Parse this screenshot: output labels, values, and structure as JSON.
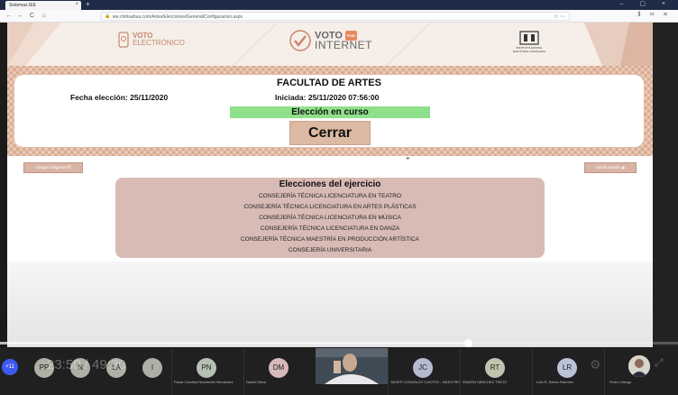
{
  "browser": {
    "tab_title": "Sistemas IEE",
    "tab_close": "×",
    "new_tab": "+",
    "window_controls": "– ▢ ×",
    "nav_back": "←",
    "nav_forward": "→",
    "nav_reload": "C",
    "nav_home": "⌂",
    "url": "iee.chihuahua.com/Artes/Elecciones/General/Configuracion.aspx",
    "url_actions": "☆ ⋯",
    "toolbar_icons": "⫴ ▭ ≡"
  },
  "header": {
    "logo_left_line1": "VOTO",
    "logo_left_line2": "ELECTRÓNICO",
    "logo_center_line1": "VOTO",
    "logo_center_badge": "POR",
    "logo_center_line2": "INTERNET",
    "logo_right_text": "INSTITUTO ESTATAL ELECTORAL CHIHUAHUA"
  },
  "election": {
    "faculty": "FACULTAD DE ARTES",
    "fecha": "Fecha elección: 25/11/2020",
    "iniciada": "Iniciada: 25/11/2020 07:56:00",
    "status": "Elección en curso",
    "close_label": "Cerrar"
  },
  "actions": {
    "left_button": "Cargar imágenes ⎘",
    "right_button": "Cerrar sesión ⏏"
  },
  "elections_list": {
    "title": "Elecciones del ejercicio",
    "items": [
      "CONSEJERÍA TÉCNICA LICENCIATURA EN TEATRO",
      "CONSEJERÍA TÉCNICA LICENCIATURA EN ARTES PLÁSTICAS",
      "CONSEJERÍA TÉCNICA LICENCIATURA EN MÚSICA",
      "CONSEJERÍA TÉCNICA LICENCIATURA EN DANZA",
      "CONSEJERÍA TÉCNICA MAESTRÍA EN PRODUCCIÓN ARTÍSTICA",
      "CONSEJERÍA UNIVERSITARIA"
    ]
  },
  "video": {
    "timecode": "23:50 / 49:30",
    "progress": 0.69
  },
  "participants": {
    "more_count": "+11",
    "avatars": [
      {
        "initials": "PP"
      },
      {
        "initials": "N"
      },
      {
        "initials": "LA"
      },
      {
        "initials": "I"
      },
      {
        "initials": "PN",
        "name": "Paola Carolina Navarrete Hernández"
      },
      {
        "initials": "DM",
        "name": "Daniel Meza"
      },
      {
        "initials": "JC",
        "name": "JAVIER GONZÁLEZ CASTRO - MAESTRO"
      },
      {
        "initials": "RT",
        "name": "RAMÓN SÁNCHEZ TREJO"
      },
      {
        "initials": "LR",
        "name": "Luis R. Sáenz Ramírez"
      },
      {
        "initials": "",
        "name": "Pedro Ortega"
      }
    ]
  }
}
